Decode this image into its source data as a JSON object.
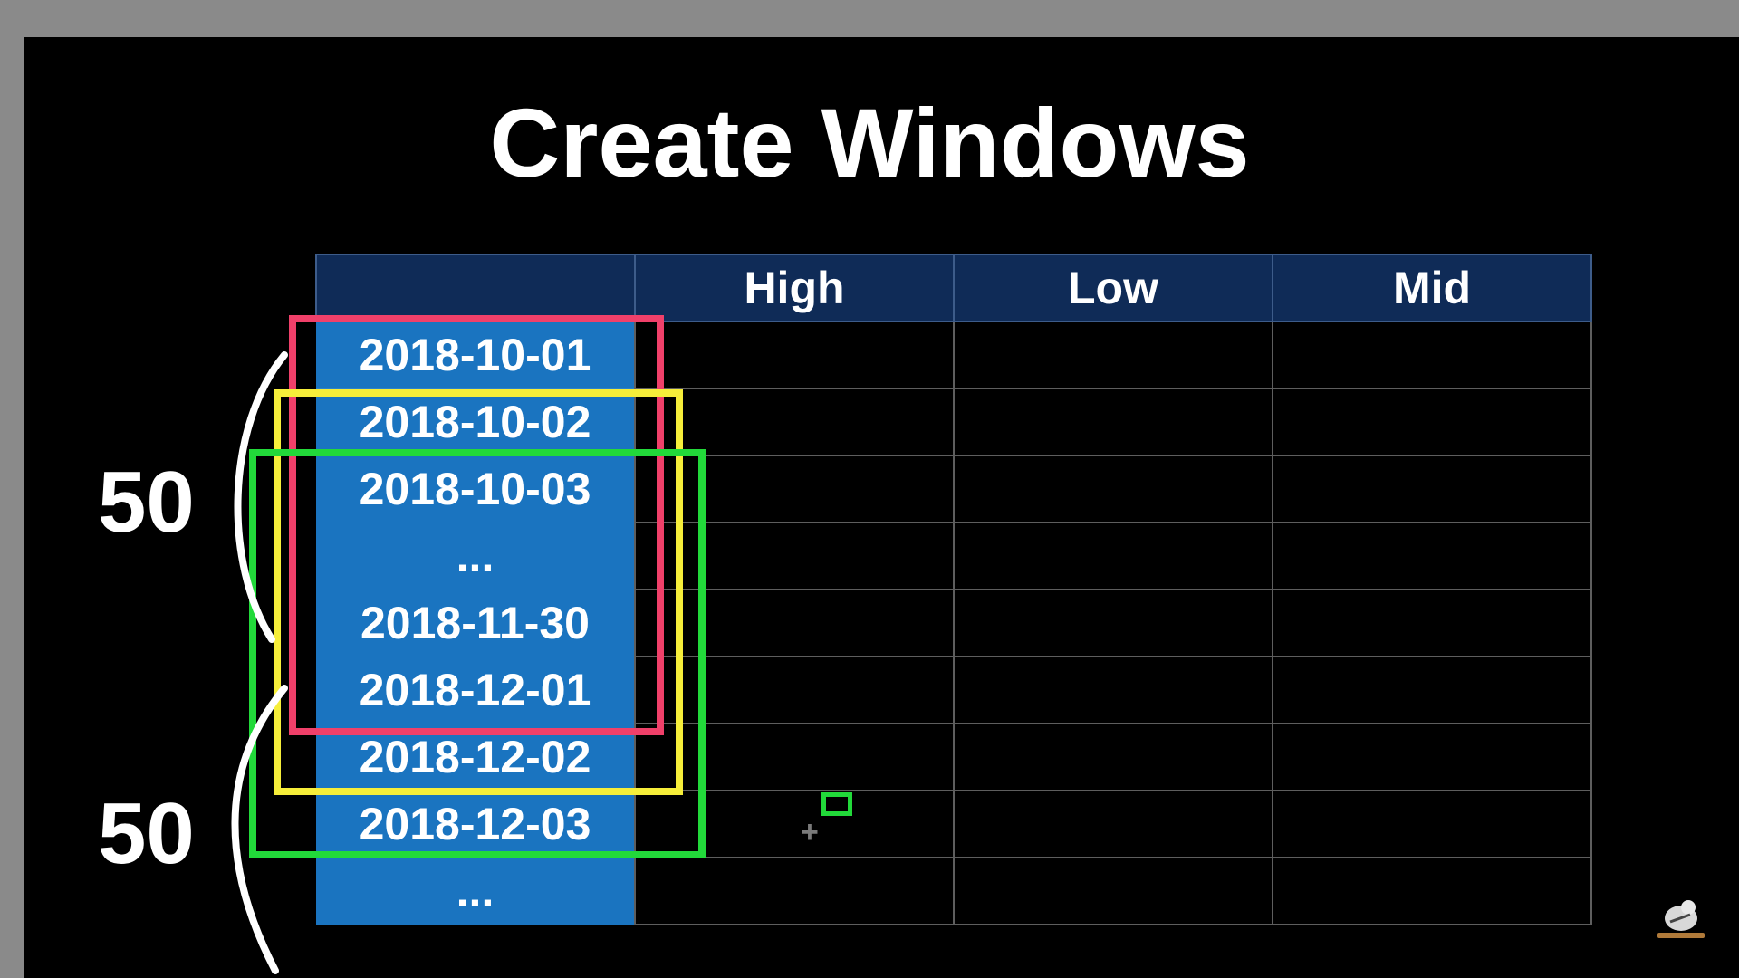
{
  "slide": {
    "title": "Create Windows"
  },
  "table": {
    "headers": [
      "",
      "High",
      "Low",
      "Mid"
    ],
    "rows": [
      "2018-10-01",
      "2018-10-02",
      "2018-10-03",
      "...",
      "2018-11-30",
      "2018-12-01",
      "2018-12-02",
      "2018-12-03",
      "..."
    ]
  },
  "window_labels": {
    "first": "50",
    "second": "50"
  },
  "colors": {
    "header_bg": "#0f2b57",
    "date_cell_bg": "#1a74c0",
    "window_1": "#f0406a",
    "window_2": "#f6ee3a",
    "window_3": "#22d93a"
  },
  "icons": {
    "cursor": "crosshair-cursor-icon",
    "logo": "channel-logo-icon"
  }
}
